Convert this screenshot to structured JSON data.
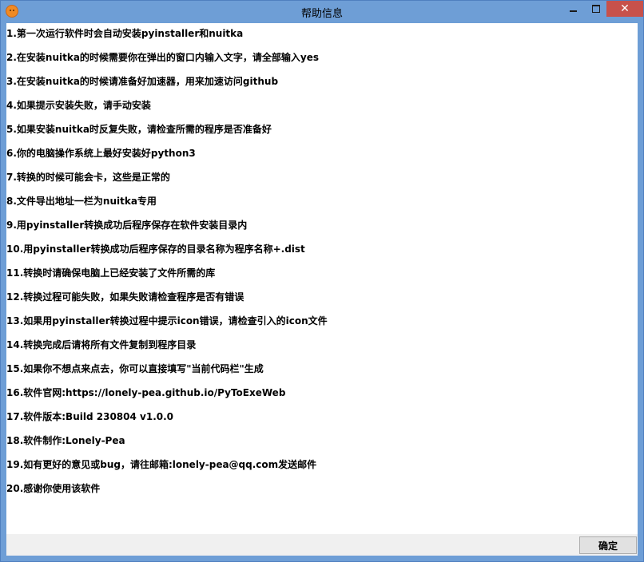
{
  "window": {
    "title": "帮助信息",
    "close_label": "✕",
    "accent_color": "#6e9ed6",
    "close_color": "#c7514b"
  },
  "help_lines": [
    "1.第一次运行软件时会自动安装pyinstaller和nuitka",
    "2.在安装nuitka的时候需要你在弹出的窗口内输入文字，请全部输入yes",
    "3.在安装nuitka的时候请准备好加速器，用来加速访问github",
    "4.如果提示安装失败，请手动安装",
    "5.如果安装nuitka时反复失败，请检查所需的程序是否准备好",
    "6.你的电脑操作系统上最好安装好python3",
    "7.转换的时候可能会卡，这些是正常的",
    "8.文件导出地址一栏为nuitka专用",
    "9.用pyinstaller转换成功后程序保存在软件安装目录内",
    "10.用pyinstaller转换成功后程序保存的目录名称为程序名称+.dist",
    "11.转换时请确保电脑上已经安装了文件所需的库",
    "12.转换过程可能失败，如果失败请检查程序是否有错误",
    "13.如果用pyinstaller转换过程中提示icon错误，请检查引入的icon文件",
    "14.转换完成后请将所有文件复制到程序目录",
    "15.如果你不想点来点去，你可以直接填写\"当前代码栏\"生成",
    "16.软件官网:https://lonely-pea.github.io/PyToExeWeb",
    "17.软件版本:Build 230804 v1.0.0",
    "18.软件制作:Lonely-Pea",
    "19.如有更好的意见或bug，请往邮箱:lonely-pea@qq.com发送邮件",
    "20.感谢你使用该软件"
  ],
  "footer": {
    "ok_label": "确定"
  }
}
